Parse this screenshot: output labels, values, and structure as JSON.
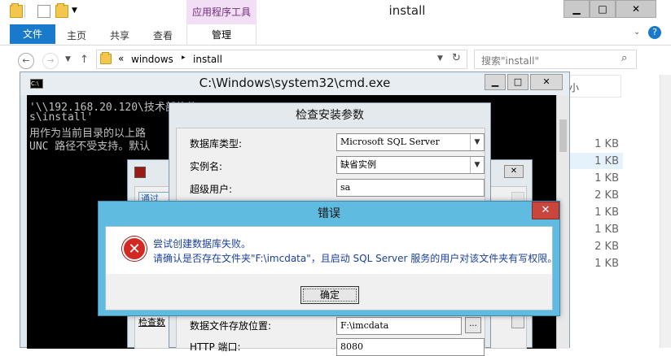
{
  "explorer": {
    "title": "install",
    "tools_tab": "应用程序工具",
    "ribbon_tabs": {
      "file": "文件",
      "home": "主页",
      "share": "共享",
      "view": "查看",
      "manage": "管理"
    },
    "window_buttons": {
      "minimize": "▁",
      "maximize": "□",
      "close": "✕"
    },
    "address": {
      "chevron": "«",
      "crumb1": "windows",
      "sep": "▸",
      "crumb2": "install"
    },
    "search_placeholder": "搜索\"install\"",
    "size_header": "小",
    "sizes": [
      "1 KB",
      "1 KB",
      "1 KB",
      "2 KB",
      "1 KB",
      "1 KB",
      "2 KB",
      "1 KB"
    ]
  },
  "cmd": {
    "title": "C:\\Windows\\system32\\cmd.exe",
    "lines": [
      "'\\\\192.168.20.120\\技术部软件\\H3C\\H3C IMC PLAT 7.2 E0503\\windows\\window",
      "s\\install'",
      "用作为当前目录的以上路",
      "UNC 路径不受支持。默认"
    ]
  },
  "check_dialog": {
    "title": "检查安装参数",
    "db_type_label": "数据库类型:",
    "db_type_value": "Microsoft SQL Server",
    "instance_label": "实例名:",
    "instance_value": "缺省实例",
    "superuser_label": "超级用户:",
    "superuser_value": "sa",
    "datafile_label": "数据文件存放位置:",
    "datafile_value": "F:\\imcdata",
    "browse": "...",
    "http_label": "HTTP 端口:",
    "http_value": "8080"
  },
  "bg_dialog": {
    "pass_label": "通过",
    "check_label": "检查数"
  },
  "error_dialog": {
    "title": "错误",
    "close": "✕",
    "line1": "尝试创建数据库失败。",
    "line2": "请确认是否存在文件夹\"F:\\imcdata\"，且启动 SQL Server 服务的用户对该文件夹有写权限。",
    "ok": "确定"
  }
}
